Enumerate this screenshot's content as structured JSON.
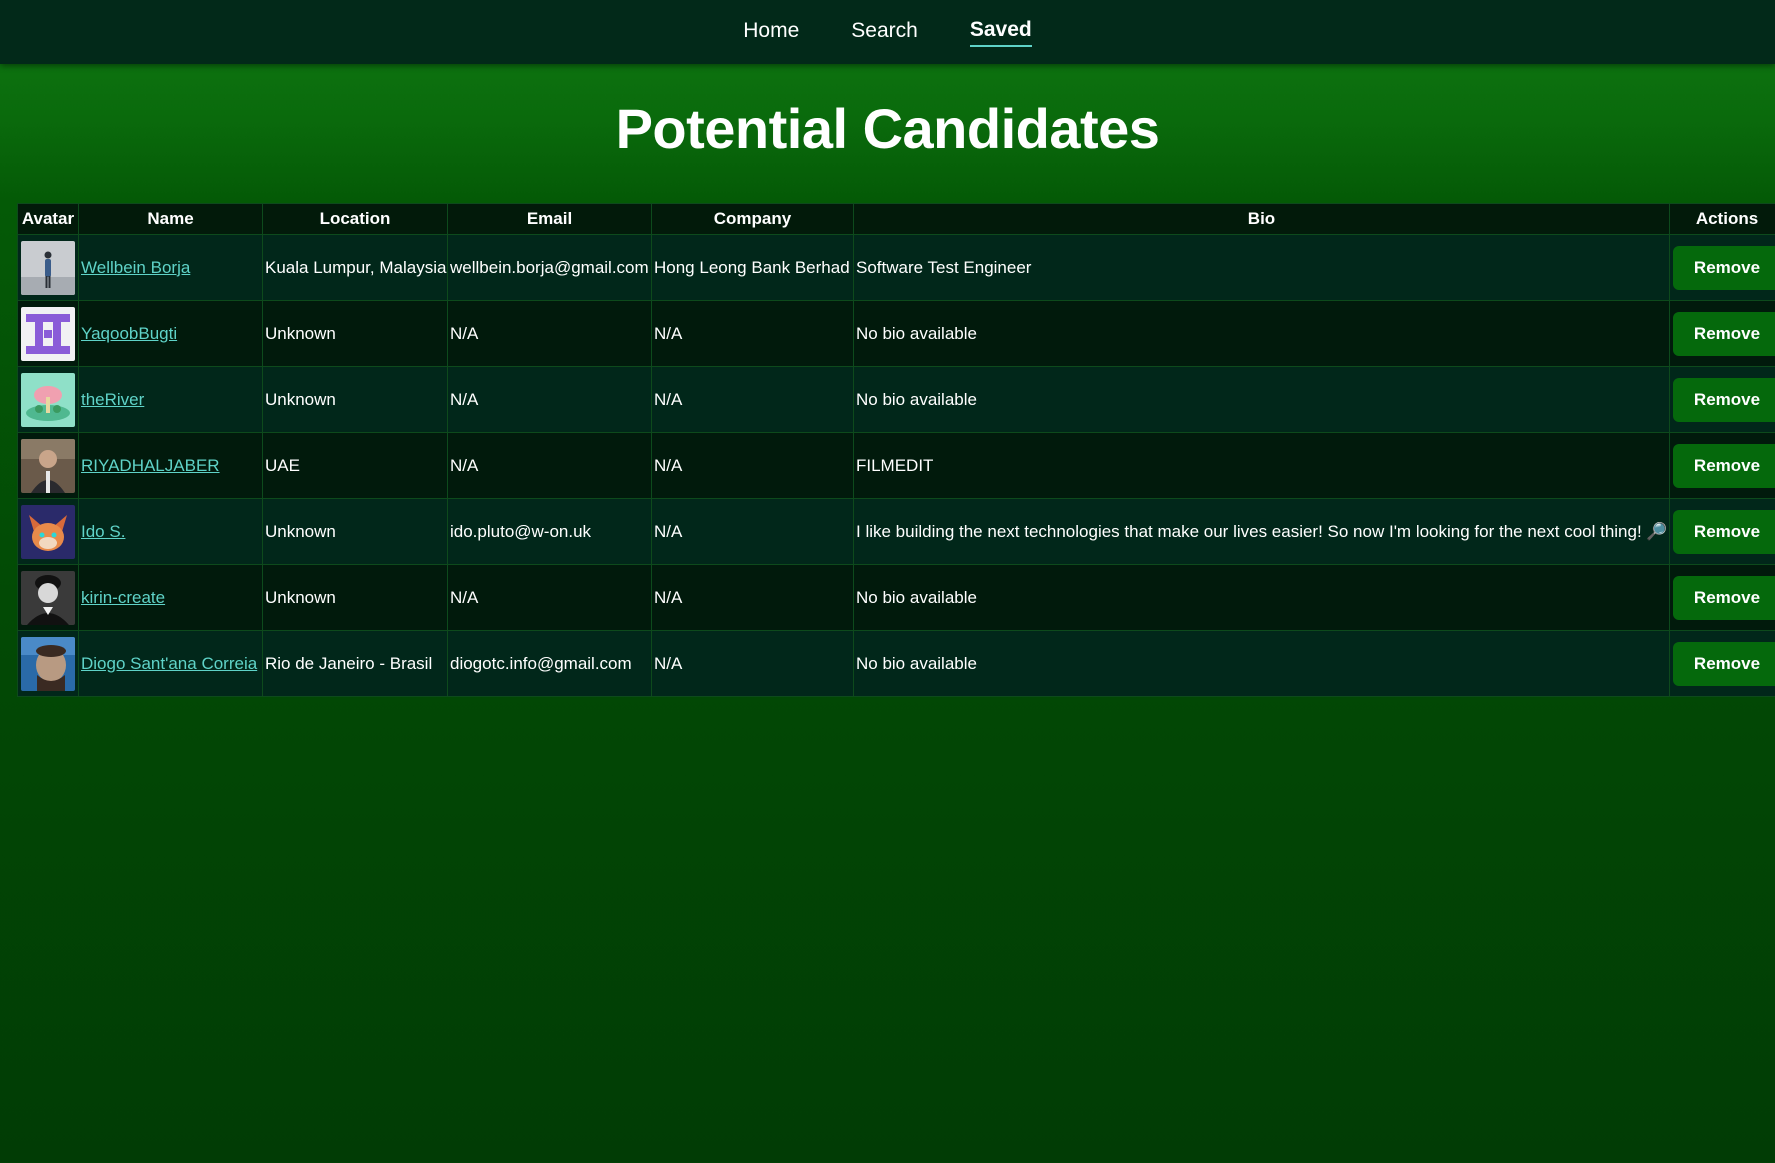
{
  "nav": {
    "items": [
      {
        "label": "Home",
        "active": false
      },
      {
        "label": "Search",
        "active": false
      },
      {
        "label": "Saved",
        "active": true
      }
    ]
  },
  "page": {
    "title": "Potential Candidates"
  },
  "table": {
    "headers": [
      "Avatar",
      "Name",
      "Location",
      "Email",
      "Company",
      "Bio",
      "Actions"
    ],
    "rows": [
      {
        "name": "Wellbein Borja",
        "location": "Kuala Lumpur, Malaysia",
        "email": "wellbein.borja@gmail.com",
        "company": "Hong Leong Bank Berhad",
        "bio": "Software Test Engineer",
        "action": "Remove"
      },
      {
        "name": "YaqoobBugti",
        "location": "Unknown",
        "email": "N/A",
        "company": "N/A",
        "bio": "No bio available",
        "action": "Remove"
      },
      {
        "name": "theRiver",
        "location": "Unknown",
        "email": "N/A",
        "company": "N/A",
        "bio": "No bio available",
        "action": "Remove"
      },
      {
        "name": "RIYADHALJABER",
        "location": "UAE",
        "email": "N/A",
        "company": "N/A",
        "bio": "FILMEDIT",
        "action": "Remove"
      },
      {
        "name": "Ido S.",
        "location": "Unknown",
        "email": "ido.pluto@w-on.uk",
        "company": "N/A",
        "bio": "I like building the next technologies that make our lives easier! So now I'm looking for the next cool thing!",
        "bio_icon": "magnifier-icon",
        "action": "Remove"
      },
      {
        "name": "kirin-create",
        "location": "Unknown",
        "email": "N/A",
        "company": "N/A",
        "bio": "No bio available",
        "action": "Remove"
      },
      {
        "name": "Diogo Sant'ana Correia",
        "location": "Rio de Janeiro - Brasil",
        "email": "diogotc.info@gmail.com",
        "company": "N/A",
        "bio": "No bio available",
        "action": "Remove"
      }
    ]
  },
  "colors": {
    "nav_bg": "#022919",
    "link": "#5fd3c8",
    "button": "#05690c"
  }
}
